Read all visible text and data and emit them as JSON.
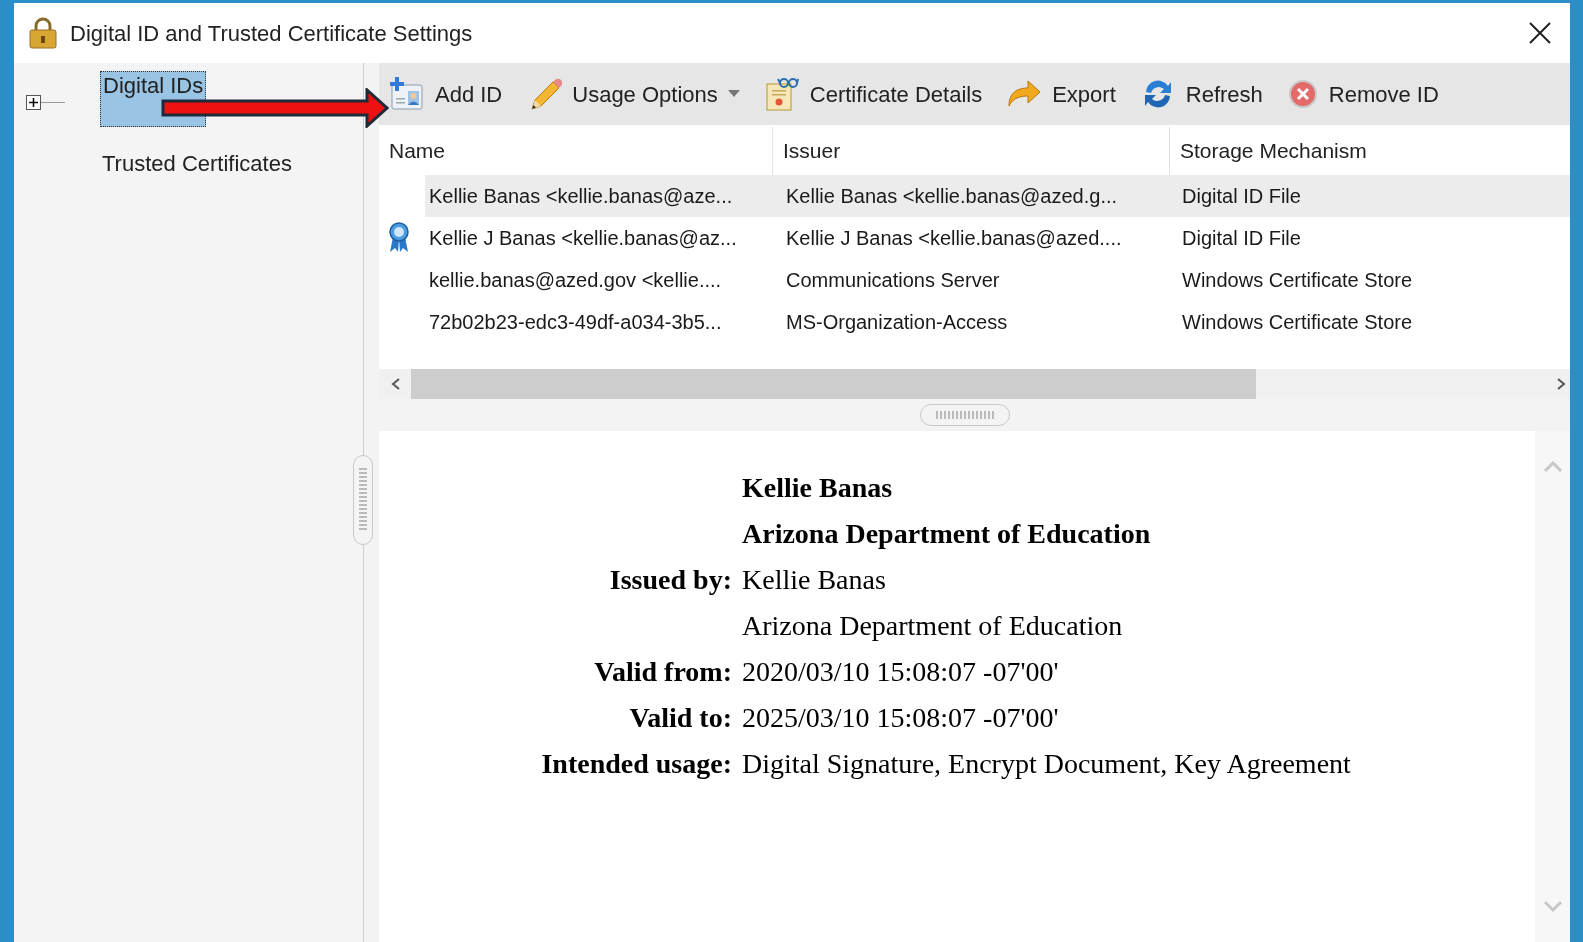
{
  "window": {
    "title": "Digital ID and Trusted Certificate Settings"
  },
  "sidebar": {
    "items": [
      {
        "kind": "group",
        "label": "Digital IDs",
        "selected": true,
        "expanded": false
      },
      {
        "kind": "leaf",
        "label": "Trusted Certificates",
        "selected": false
      }
    ]
  },
  "toolbar": [
    {
      "kind": "add",
      "label": "Add ID",
      "has_menu": false
    },
    {
      "kind": "usage",
      "label": "Usage Options",
      "has_menu": true
    },
    {
      "kind": "details",
      "label": "Certificate Details",
      "has_menu": false
    },
    {
      "kind": "export",
      "label": "Export",
      "has_menu": false
    },
    {
      "kind": "refresh",
      "label": "Refresh",
      "has_menu": false
    },
    {
      "kind": "remove",
      "label": "Remove ID",
      "has_menu": false
    }
  ],
  "table": {
    "columns": [
      "Name",
      "Issuer",
      "Storage Mechanism"
    ],
    "rows": [
      {
        "kind": "plain",
        "selected": true,
        "cells": [
          "Kellie Banas <kellie.banas@aze...",
          "Kellie Banas <kellie.banas@azed.g...",
          "Digital ID File"
        ]
      },
      {
        "kind": "certified",
        "selected": false,
        "cells": [
          "Kellie J Banas <kellie.banas@az...",
          "Kellie J Banas <kellie.banas@azed....",
          "Digital ID File"
        ]
      },
      {
        "kind": "plain",
        "selected": false,
        "cells": [
          "kellie.banas@azed.gov <kellie....",
          "Communications Server",
          "Windows Certificate Store"
        ]
      },
      {
        "kind": "plain",
        "selected": false,
        "cells": [
          "72b02b23-edc3-49df-a034-3b5...",
          "MS-Organization-Access",
          "Windows Certificate Store"
        ]
      }
    ]
  },
  "details": [
    {
      "kind": "heading",
      "value": "Kellie Banas"
    },
    {
      "kind": "heading",
      "value": "Arizona Department of Education"
    },
    {
      "kind": "field",
      "label": "Issued by:",
      "value": "Kellie Banas"
    },
    {
      "kind": "field",
      "value": "Arizona Department of Education"
    },
    {
      "kind": "field",
      "label": "Valid from:",
      "value": "2020/03/10 15:08:07 -07'00'"
    },
    {
      "kind": "field",
      "label": "Valid to:",
      "value": "2025/03/10 15:08:07 -07'00'"
    },
    {
      "kind": "field",
      "label": "Intended usage:",
      "value": "Digital Signature, Encrypt Document, Key Agreement"
    }
  ]
}
